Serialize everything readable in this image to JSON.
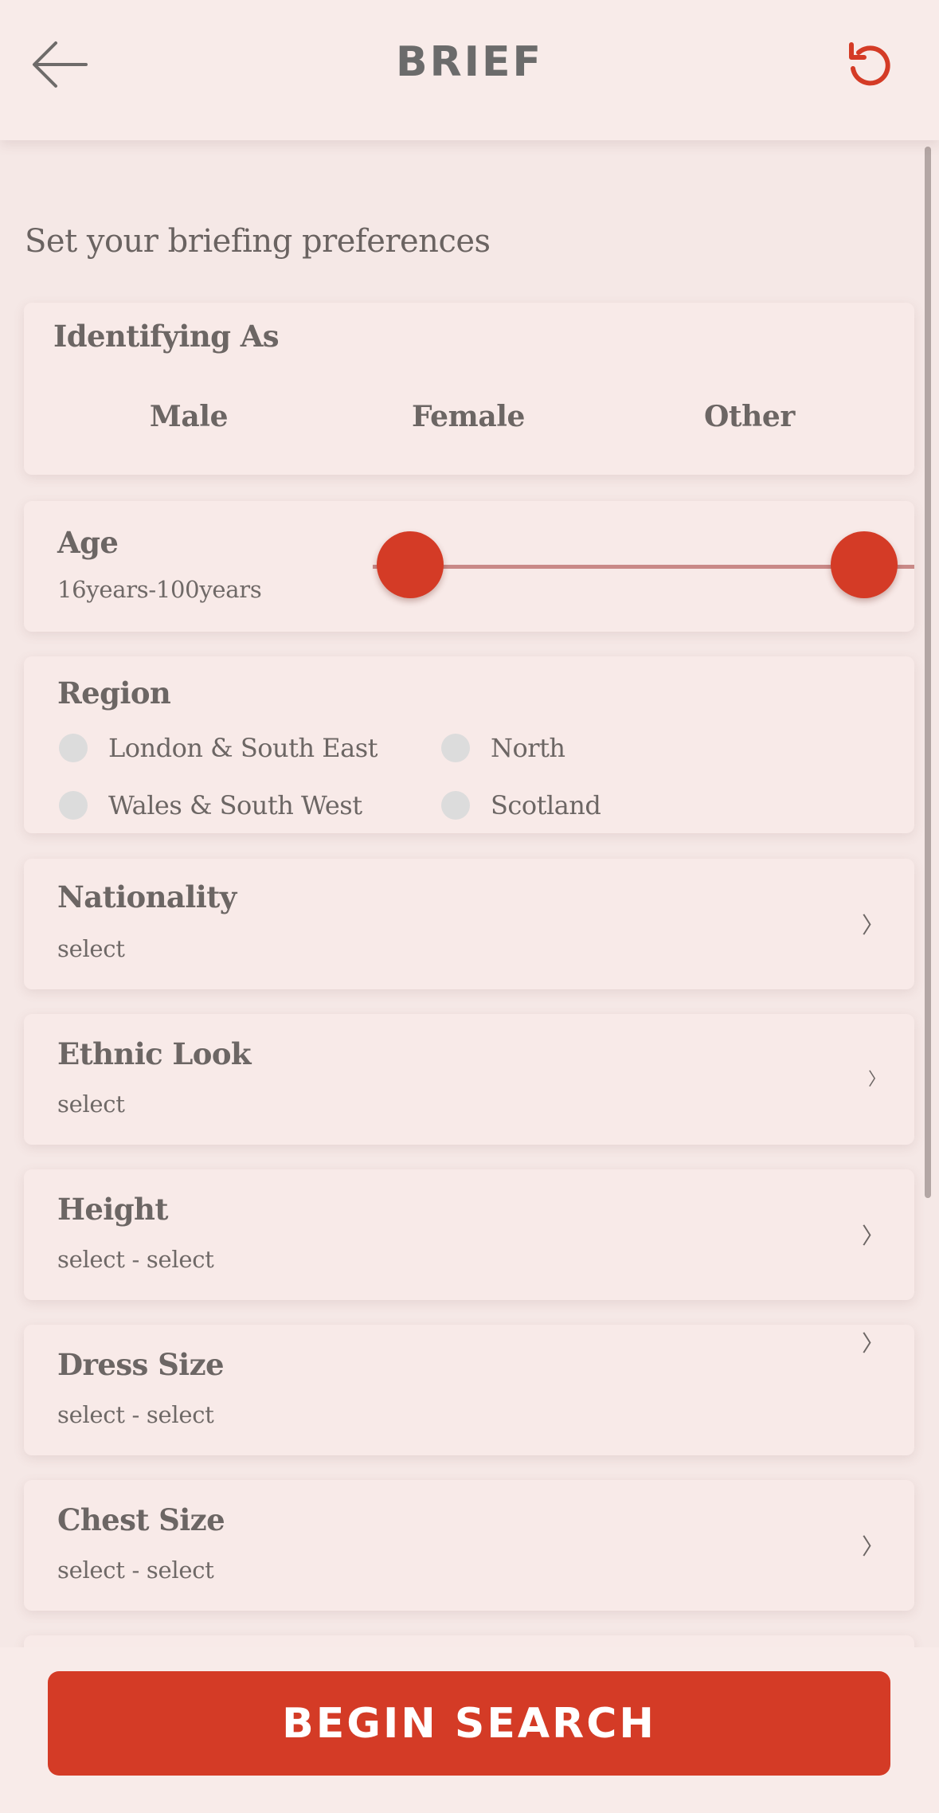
{
  "header": {
    "title": "BRIEF",
    "back_icon": "arrow-left-icon",
    "reset_icon": "refresh-icon",
    "accent_color": "#d43b26"
  },
  "intro": "Set your briefing preferences",
  "identifying": {
    "label": "Identifying As",
    "options": [
      "Male",
      "Female",
      "Other"
    ]
  },
  "age": {
    "label": "Age",
    "range_text": "16years-100years",
    "min": 16,
    "max": 100
  },
  "region": {
    "label": "Region",
    "options": [
      "London & South East",
      "North",
      "Wales & South West",
      "Scotland"
    ]
  },
  "fields": [
    {
      "label": "Nationality",
      "value": "select"
    },
    {
      "label": "Ethnic Look",
      "value": "select"
    },
    {
      "label": "Height",
      "value": "select - select"
    },
    {
      "label": "Dress Size",
      "value": "select - select"
    },
    {
      "label": "Chest Size",
      "value": "select - select"
    }
  ],
  "chevron_glyph": "〉",
  "footer": {
    "button_label": "BEGIN SEARCH"
  }
}
